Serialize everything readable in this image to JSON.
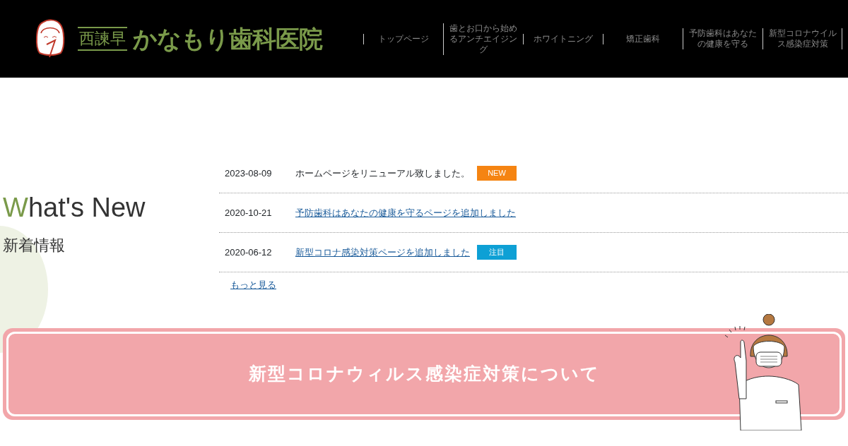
{
  "header": {
    "logo_sub": "西諫早",
    "logo_main": "かなもり歯科医院",
    "nav": [
      {
        "label": "トップページ"
      },
      {
        "label": "歯とお口から始めるアンチエイジング"
      },
      {
        "label": "ホワイトニング"
      },
      {
        "label": "矯正歯科"
      },
      {
        "label": "予防歯科はあなたの健康を守る"
      },
      {
        "label": "新型コロナウイルス感染症対策"
      }
    ]
  },
  "whats_new": {
    "title_initial": "W",
    "title_rest": "hat's New",
    "subtitle": "新着情報",
    "items": [
      {
        "date": "2023-08-09",
        "text": "ホームページをリニューアル致しました。",
        "kind": "text",
        "tag": "NEW",
        "color": "#f58412"
      },
      {
        "date": "2020-10-21",
        "text": "予防歯科はあなたの健康を守るページを追加しました",
        "kind": "link"
      },
      {
        "date": "2020-06-12",
        "text": "新型コロナ感染対策ページを追加しました",
        "kind": "link",
        "tag": "注目",
        "color": "#0ea0d5"
      }
    ],
    "more": "もっと見る"
  },
  "banner": {
    "text": "新型コロナウィルス感染症対策について"
  }
}
